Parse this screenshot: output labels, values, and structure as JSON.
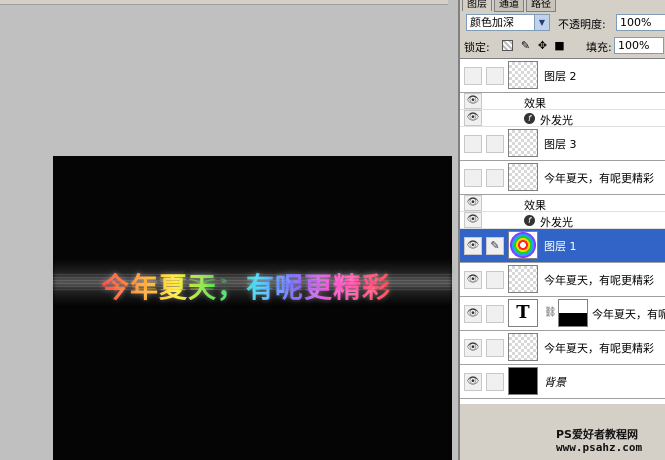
{
  "tabs": [
    "图层",
    "通道",
    "路径"
  ],
  "blend_mode": "颜色加深",
  "opacity_label": "不透明度:",
  "opacity_value": "100%",
  "lock_label": "锁定:",
  "fill_label": "填充:",
  "fill_value": "100%",
  "canvas_text": "今年夏天，有呢更精彩",
  "layers": [
    {
      "name": "图层 2",
      "thumb": "transparent",
      "visible": false
    },
    {
      "effects_label": "效果"
    },
    {
      "effect": "外发光"
    },
    {
      "name": "图层 3",
      "thumb": "transparent",
      "visible": false
    },
    {
      "name": "今年夏天，有呢更精彩",
      "thumb": "transparent",
      "visible": false
    },
    {
      "effects_label": "效果"
    },
    {
      "effect": "外发光"
    },
    {
      "name": "图层 1",
      "thumb": "ring",
      "visible": true,
      "selected": true
    },
    {
      "name": "今年夏天，有呢更精彩",
      "thumb": "transparent",
      "visible": true
    },
    {
      "name": "今年夏天，有呢",
      "thumb": "text",
      "visible": true,
      "mask": true
    },
    {
      "name": "今年夏天，有呢更精彩",
      "thumb": "transparent",
      "visible": true
    },
    {
      "name": "背景",
      "thumb": "black",
      "visible": true
    }
  ],
  "watermark": {
    "line1": "PS爱好者教程网",
    "line2": "www.psahz.com"
  },
  "icons": {
    "eye": "eye-icon",
    "brush": "brush-icon",
    "chain": "chain-link-icon",
    "fx": "effects-icon"
  }
}
